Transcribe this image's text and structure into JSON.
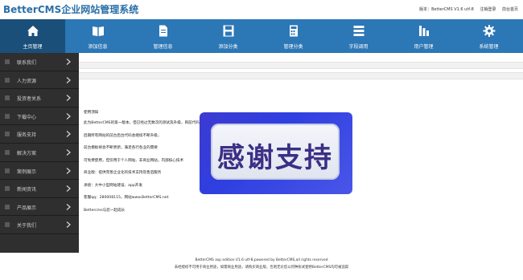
{
  "header": {
    "logo": "BetterCMS企业网站管理系统",
    "version": "版本：BetterCMS V1.6 utf-8",
    "logout": "注销登录",
    "home": "前台首页"
  },
  "nav": {
    "items": [
      {
        "label": "主页管理",
        "icon": "home-icon"
      },
      {
        "label": "添加信息",
        "icon": "book-icon"
      },
      {
        "label": "管理信息",
        "icon": "document-icon"
      },
      {
        "label": "添加分类",
        "icon": "save-icon"
      },
      {
        "label": "管理分类",
        "icon": "calculator-icon"
      },
      {
        "label": "字段调用",
        "icon": "list-icon"
      },
      {
        "label": "用户管理",
        "icon": "users-icon"
      },
      {
        "label": "系统管理",
        "icon": "gear-icon"
      }
    ]
  },
  "sidebar": {
    "items": [
      {
        "label": "联系我们"
      },
      {
        "label": "人力资源"
      },
      {
        "label": "投资者关系"
      },
      {
        "label": "下载中心"
      },
      {
        "label": "服务支持"
      },
      {
        "label": "解决方案"
      },
      {
        "label": "案例展示"
      },
      {
        "label": "新闻资讯"
      },
      {
        "label": "产品展示"
      },
      {
        "label": "关于我们"
      }
    ]
  },
  "content": {
    "lines": [
      "使用须知",
      "此为BetterCMS的第一版本，但已经过无数次的测试及升级，目前代码及功能健全，完全适合中小企业网站使用：",
      "后期所有网站的前台后台代码会继续不断升级，",
      "前台模板将会不断更新，满足各行各业的需要",
      "可免费使用，但仅用于个人网站、非商业网站，内部核心技术",
      "商业版：提供完善企业化的技术支持及售后服务",
      "承接：大中小型网站建设、app开发",
      "客服qq：280008115，网站www.BetterCMS.net",
      "Bettercms与您一起成长"
    ]
  },
  "overlay": {
    "text": "感谢支持"
  },
  "footer": {
    "line1": "BetterCMS asp edition V1.6 utf-8,powered by BetterCMS,all rights reserved",
    "line2": "未经授权不可用于商业用途，如需商业用途，请购买商业版，否则无论您以何种形式使用BetterCMS均可被追踪"
  },
  "colors": {
    "brand": "#2c77b6",
    "nav_active": "#1a4f7a",
    "sidebar_bg": "#2f2f2f"
  }
}
